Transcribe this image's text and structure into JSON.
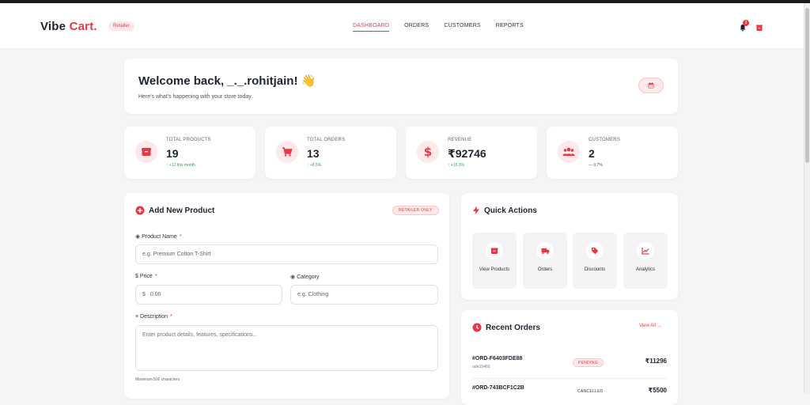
{
  "brand": {
    "name_part1": "Vibe",
    "name_part2": "Cart.",
    "role": "Retailer"
  },
  "nav": [
    {
      "label": "DASHBOARD",
      "active": true
    },
    {
      "label": "ORDERS",
      "active": false
    },
    {
      "label": "CUSTOMERS",
      "active": false
    },
    {
      "label": "REPORTS",
      "active": false
    }
  ],
  "notifications": {
    "count": "3",
    "icon": "bell-icon"
  },
  "welcome": {
    "title": "Welcome back, _._.rohitjain! 👋",
    "subtitle": "Here's what's happening with your store today."
  },
  "stats": [
    {
      "label": "TOTAL PRODUCTS",
      "value": "19",
      "change": "↑ +12 this month",
      "icon": "box-icon"
    },
    {
      "label": "TOTAL ORDERS",
      "value": "13",
      "change": "↑ +8.5%",
      "icon": "cart-icon"
    },
    {
      "label": "REVENUE",
      "value": "₹92746",
      "change": "↑ +15.3%",
      "icon": "dollar-icon"
    },
    {
      "label": "CUSTOMERS",
      "value": "2",
      "change": "— 0.7%",
      "icon": "users-icon"
    }
  ],
  "add_product": {
    "title": "Add New Product",
    "badge": "RETAILER ONLY",
    "name_label": "Product Name",
    "name_placeholder": "e.g. Premium Cotton T-Shirt",
    "price_label": "Price",
    "price_placeholder": "0.00",
    "currency_symbol": "$",
    "category_label": "Category",
    "category_placeholder": "e.g. Clothing",
    "description_label": "Description",
    "description_placeholder": "Enter product details, features, specifications...",
    "description_hint": "Maximum 500 characters",
    "required_mark": "*"
  },
  "quick_actions": {
    "title": "Quick Actions",
    "items": [
      {
        "label": "View Products",
        "icon": "box-icon"
      },
      {
        "label": "Orders",
        "icon": "truck-icon"
      },
      {
        "label": "Discounts",
        "icon": "tag-icon"
      },
      {
        "label": "Analytics",
        "icon": "chart-icon"
      }
    ]
  },
  "recent_orders": {
    "title": "Recent Orders",
    "view_all": "View All →",
    "items": [
      {
        "id": "#ORD-F6403FDE88",
        "user": "rafe15460",
        "status": "PENDING",
        "amount": "₹11296"
      },
      {
        "id": "#ORD-743BCF1C2B",
        "user": "",
        "status": "CANCELLED",
        "amount": "₹5500"
      }
    ]
  },
  "colors": {
    "accent": "#e63946",
    "accent_light": "#fde8ea",
    "success": "#2aa84a"
  }
}
